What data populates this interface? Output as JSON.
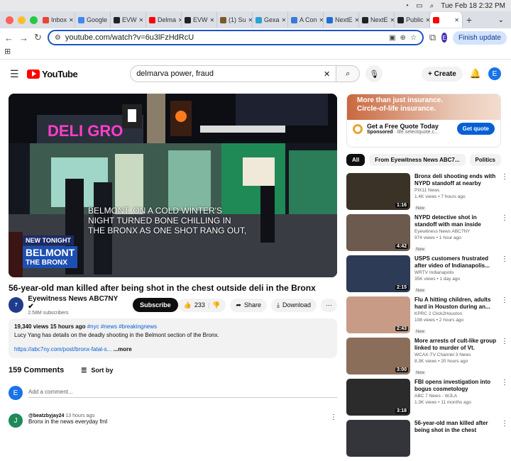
{
  "menubar": {
    "datetime": "Tue Feb 18  2:32 PM"
  },
  "tabs": [
    {
      "label": "Inbox",
      "color": "#ea4335"
    },
    {
      "label": "Google",
      "color": "#4285f4"
    },
    {
      "label": "EVW",
      "color": "#222222"
    },
    {
      "label": "Delma",
      "color": "#ff0000"
    },
    {
      "label": "EVW",
      "color": "#222222"
    },
    {
      "label": "(1) Su",
      "color": "#7a5a2a"
    },
    {
      "label": "Gexa",
      "color": "#2aa1d9"
    },
    {
      "label": "A Con",
      "color": "#3a7bd5"
    },
    {
      "label": "NextE",
      "color": "#1f6fd1"
    },
    {
      "label": "NextE",
      "color": "#222222"
    },
    {
      "label": "Public",
      "color": "#222222"
    },
    {
      "label": "",
      "color": "#ff0000",
      "active": true
    }
  ],
  "address": {
    "url": "youtube.com/watch?v=6u3lFzHdRcU",
    "profile": "E",
    "finish_update": "Finish update"
  },
  "yt": {
    "logo": "YouTube",
    "search_query": "delmarva power, fraud",
    "create": "Create",
    "avatar": "E"
  },
  "video": {
    "caption": [
      "BELMONT. ON A COLD WINTER'S",
      "NIGHT TURNED BONE CHILLING IN",
      "THE BRONX AS ONE SHOT RANG OUT,"
    ],
    "lower_tag": "NEW TONIGHT",
    "lower_place": "BELMONT",
    "lower_sub": "THE BRONX",
    "title": "56-year-old man killed after being shot in the chest outside deli in the Bronx",
    "channel": "Eyewitness News ABC7NY",
    "subscribers": "2.58M subscribers",
    "subscribe": "Subscribe",
    "likes": "233",
    "share": "Share",
    "download": "Download",
    "desc_views": "19,340 views  15 hours ago",
    "desc_tags": "#nyc #news #breakingnews",
    "desc_text": "Lucy Yang has details on the deadly shooting in the Belmont section of the Bronx.",
    "desc_link": "https://abc7ny.com/post/bronx-fatal-s...",
    "desc_more": "...more",
    "channel_avatar": "7"
  },
  "comments": {
    "count": "159 Comments",
    "sort": "Sort by",
    "placeholder": "Add a comment...",
    "my_avatar": "E",
    "first": {
      "avatar": "J",
      "user": "@beatzbyjay24",
      "time": "13 hours ago",
      "text": "Bronx in the news everyday fml"
    }
  },
  "ad": {
    "banner1": "More than just insurance.",
    "banner2": "Circle-of-life insurance.",
    "title": "Get a Free Quote Today",
    "sponsored": "Sponsored",
    "domain": "life.selectquote.c...",
    "cta": "Get quote"
  },
  "chips": [
    "All",
    "From Eyewitness News ABC7...",
    "Politics"
  ],
  "recs": [
    {
      "title": "Bronx deli shooting ends with NYPD standoff at nearby hom...",
      "channel": "PIX11 News",
      "meta": "1.4K views  •  7 hours ago",
      "badge": "New",
      "duration": "1:16",
      "color": "#3a3226"
    },
    {
      "title": "NYPD detective shot in standoff with man inside apartment on...",
      "channel": "Eyewitness News ABC7NY",
      "meta": "974 views  •  1 hour ago",
      "badge": "New",
      "duration": "4:42",
      "color": "#6b5a4d"
    },
    {
      "title": "USPS customers frustrated after video of Indianapolis...",
      "channel": "WRTV Indianapolis",
      "meta": "35K views  •  1 day ago",
      "badge": "New",
      "duration": "2:15",
      "color": "#2d3b56"
    },
    {
      "title": "Flu A hitting children, adults hard in Houston during an...",
      "channel": "KPRC 2 Click2Houston",
      "meta": "108 views  •  2 hours ago",
      "badge": "New",
      "duration": "2:43",
      "color": "#c89b86"
    },
    {
      "title": "More arrests of cult-like group linked to murder of Vt. Border...",
      "channel": "WCAX-TV Channel 3 News",
      "meta": "8.3K views  •  20 hours ago",
      "badge": "New",
      "duration": "3:00",
      "color": "#8a6e5a"
    },
    {
      "title": "FBI opens investigation into bogus cosmetology licenses...",
      "channel": "ABC 7 News - WJLA",
      "meta": "1.3K views  •  11 months ago",
      "badge": "",
      "duration": "3:18",
      "color": "#2b2b2b"
    },
    {
      "title": "56-year-old man killed after being shot in the chest outside...",
      "channel": "",
      "meta": "",
      "badge": "",
      "duration": "",
      "color": "#33353a"
    }
  ]
}
